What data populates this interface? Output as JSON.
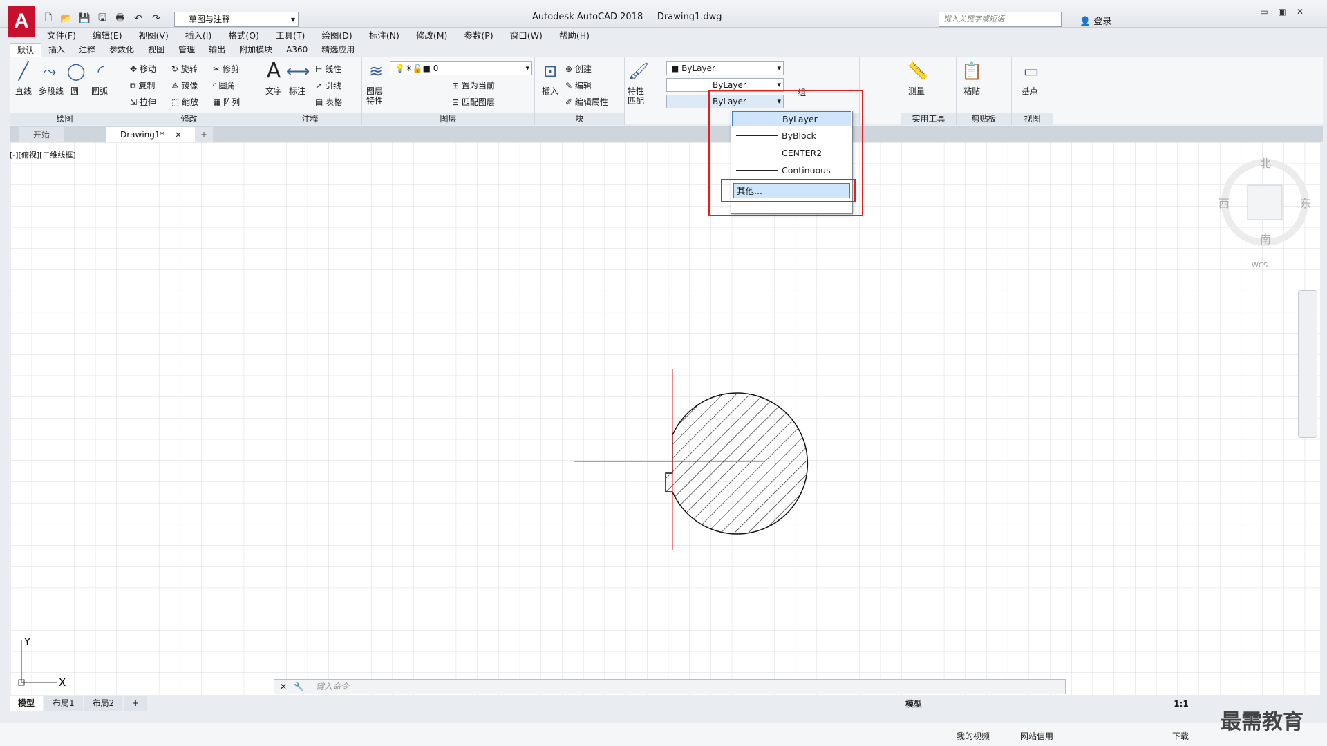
{
  "title": {
    "app": "Autodesk AutoCAD 2018",
    "doc": "Drawing1.dwg",
    "workspace": "草图与注释",
    "search_placeholder": "键入关键字或短语",
    "login": "登录",
    "logo": "A"
  },
  "menubar": [
    "文件(F)",
    "编辑(E)",
    "视图(V)",
    "插入(I)",
    "格式(O)",
    "工具(T)",
    "绘图(D)",
    "标注(N)",
    "修改(M)",
    "参数(P)",
    "窗口(W)",
    "帮助(H)"
  ],
  "ribbon_tabs": [
    "默认",
    "插入",
    "注释",
    "参数化",
    "视图",
    "管理",
    "输出",
    "附加模块",
    "A360",
    "精选应用"
  ],
  "ribbon": {
    "draw": {
      "title": "绘图",
      "line": "直线",
      "polyline": "多段线",
      "circle": "圆",
      "arc": "圆弧"
    },
    "modify": {
      "title": "修改",
      "move": "移动",
      "rotate": "旋转",
      "trim": "修剪",
      "copy": "复制",
      "mirror": "镜像",
      "fillet": "圆角",
      "stretch": "拉伸",
      "scale": "缩放",
      "array": "阵列"
    },
    "annotation": {
      "title": "注释",
      "text": "文字",
      "dimension": "标注",
      "linear": "线性",
      "leader": "引线",
      "table": "表格"
    },
    "layers": {
      "title": "图层",
      "props": "图层\n特性",
      "layer_value": "0",
      "set_current": "置为当前",
      "match": "匹配图层"
    },
    "block": {
      "title": "块",
      "insert": "插入",
      "create": "创建",
      "edit": "编辑",
      "edit_attr": "编辑属性"
    },
    "properties": {
      "match": "特性\n匹配",
      "color": "ByLayer",
      "lineweight": "ByLayer",
      "linetype": "ByLayer"
    },
    "groups": {
      "title": "组",
      "group": "组"
    },
    "utilities": {
      "title": "实用工具",
      "measure": "测量"
    },
    "clipboard": {
      "title": "剪贴板",
      "paste": "粘贴"
    },
    "view": {
      "title": "视图",
      "base": "基点"
    }
  },
  "doc_tabs": [
    "开始",
    "Drawing1*"
  ],
  "view_label": "[-][俯视][二维线框]",
  "linetype_dropdown": {
    "items": [
      "ByLayer",
      "ByBlock",
      "CENTER2",
      "Continuous"
    ],
    "other": "其他..."
  },
  "viewcube": {
    "north": "北",
    "south": "南",
    "east": "东",
    "west": "西",
    "wcs": "WCS"
  },
  "ucs": {
    "x": "X",
    "y": "Y"
  },
  "command": {
    "placeholder": "键入命令"
  },
  "layout_tabs": [
    "模型",
    "布局1",
    "布局2"
  ],
  "status": {
    "model": "模型",
    "scale": "1:1"
  },
  "taskbar": {
    "video": "我的视频",
    "credit": "网站信用",
    "download": "下载"
  },
  "watermark": "最需教育"
}
